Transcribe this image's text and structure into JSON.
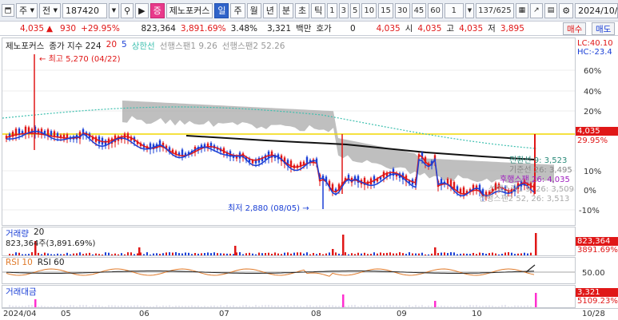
{
  "toolbar": {
    "period_type": "주",
    "mode_label": "전",
    "code": "187420",
    "stock_name": "제노포커스",
    "timeframes": [
      "일",
      "주",
      "월",
      "년",
      "분",
      "초",
      "틱"
    ],
    "intervals": [
      "1",
      "3",
      "5",
      "10",
      "15",
      "30",
      "45",
      "60",
      "1"
    ],
    "page": "137/625",
    "date": "2024/10/28"
  },
  "quote": {
    "price": "4,035",
    "change": "930",
    "change_pct": "+29.95%",
    "volume": "823,364",
    "volume_pct": "3,891.69%",
    "rate": "3.48%",
    "shares": "3,321",
    "unit_label": "백만",
    "hoga_label": "호가",
    "hoga_value": "0",
    "price2": "4,035",
    "open_label": "시",
    "open": "4,035",
    "high_label": "고",
    "high": "4,035",
    "low_label": "저",
    "low": "3,895",
    "buy_label": "매수",
    "sell_label": "매도"
  },
  "price_panel": {
    "legend_name": "제노포커스",
    "legend_ma": "종가 지수 224",
    "legend_ma20": "20",
    "legend_ma5": "5",
    "legend_upper": "상한선",
    "legend_span1": "선행스팬1 9.26",
    "legend_span2": "선행스팬2 52.26",
    "high_note": "최고 5,270 (04/22)",
    "low_note": "최저 2,880 (08/05)",
    "lc": "LC:40.10",
    "hc": "HC:-23.4",
    "pct_ticks": [
      "60%",
      "40%",
      "20%",
      "10%",
      "0%",
      "-10%"
    ],
    "current_price": "4,035",
    "current_pct": "29.95%",
    "conv_label": "전환선 9: 3,523",
    "base_label": "기준선 26: 3,495",
    "lagging_label": "후행스팬 26: 4,035",
    "span1_label": "선행스팬1 9, 26: 3,509",
    "span2_label": "선행스팬2 52, 26: 3,513"
  },
  "volume_panel": {
    "title": "거래량",
    "period": "20",
    "value": "823,364주(3,891.69%)",
    "axis_value": "823,364",
    "axis_value2": "3891.69%"
  },
  "rsi_panel": {
    "rsi_label": "RSI 10",
    "rsi60_label": "RSI 60",
    "level": "50.00"
  },
  "amount_panel": {
    "title": "거래대금",
    "axis_value": "3,321",
    "axis_value2": "5109.23%"
  },
  "x_axis": [
    "2024/04",
    "05",
    "06",
    "07",
    "08",
    "09",
    "10",
    "10/28"
  ],
  "colors": {
    "up": "#e01717",
    "down": "#1a3fd6",
    "cloud": "#a9a9a9",
    "ma224": "#111111",
    "ma20": "#e01717",
    "ma5": "#1a3fd6",
    "upper": "#3bbfae",
    "hline": "#f2d700"
  }
}
